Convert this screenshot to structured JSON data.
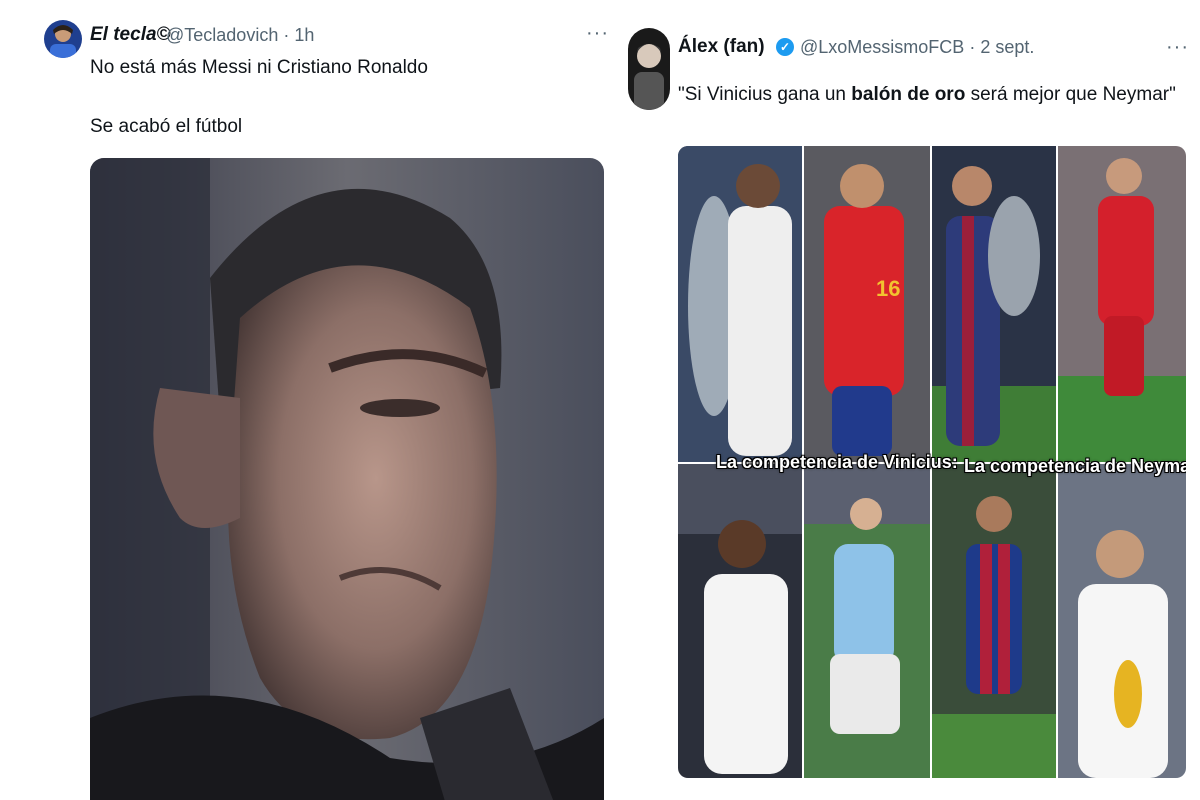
{
  "tweet_left": {
    "display_name": "El tecla",
    "name_emoji": "©",
    "handle": "@Tecladovich",
    "time": "1h",
    "line1": "No está más Messi ni Cristiano Ronaldo",
    "line2": "Se acabó el fútbol",
    "more": "···",
    "avatar_icon": "avatar",
    "media_icon": "man-closeup-photo"
  },
  "tweet_right": {
    "display_name": "Álex (fan)",
    "verified": "✓",
    "handle": "@LxoMessismoFCB",
    "time": "2 sept.",
    "text_pre": "\"Si Vinicius gana un ",
    "text_bold": "balón de oro",
    "text_post": " será mejor que Neymar\"",
    "more": "···",
    "caption_left": "La competencia de Vinicius:",
    "caption_right": "La competencia de Neymar",
    "collage_icon": "football-players-collage"
  },
  "colors": {
    "link_gray": "#536471",
    "blue": "#1d9bf0",
    "text": "#0f1419"
  }
}
